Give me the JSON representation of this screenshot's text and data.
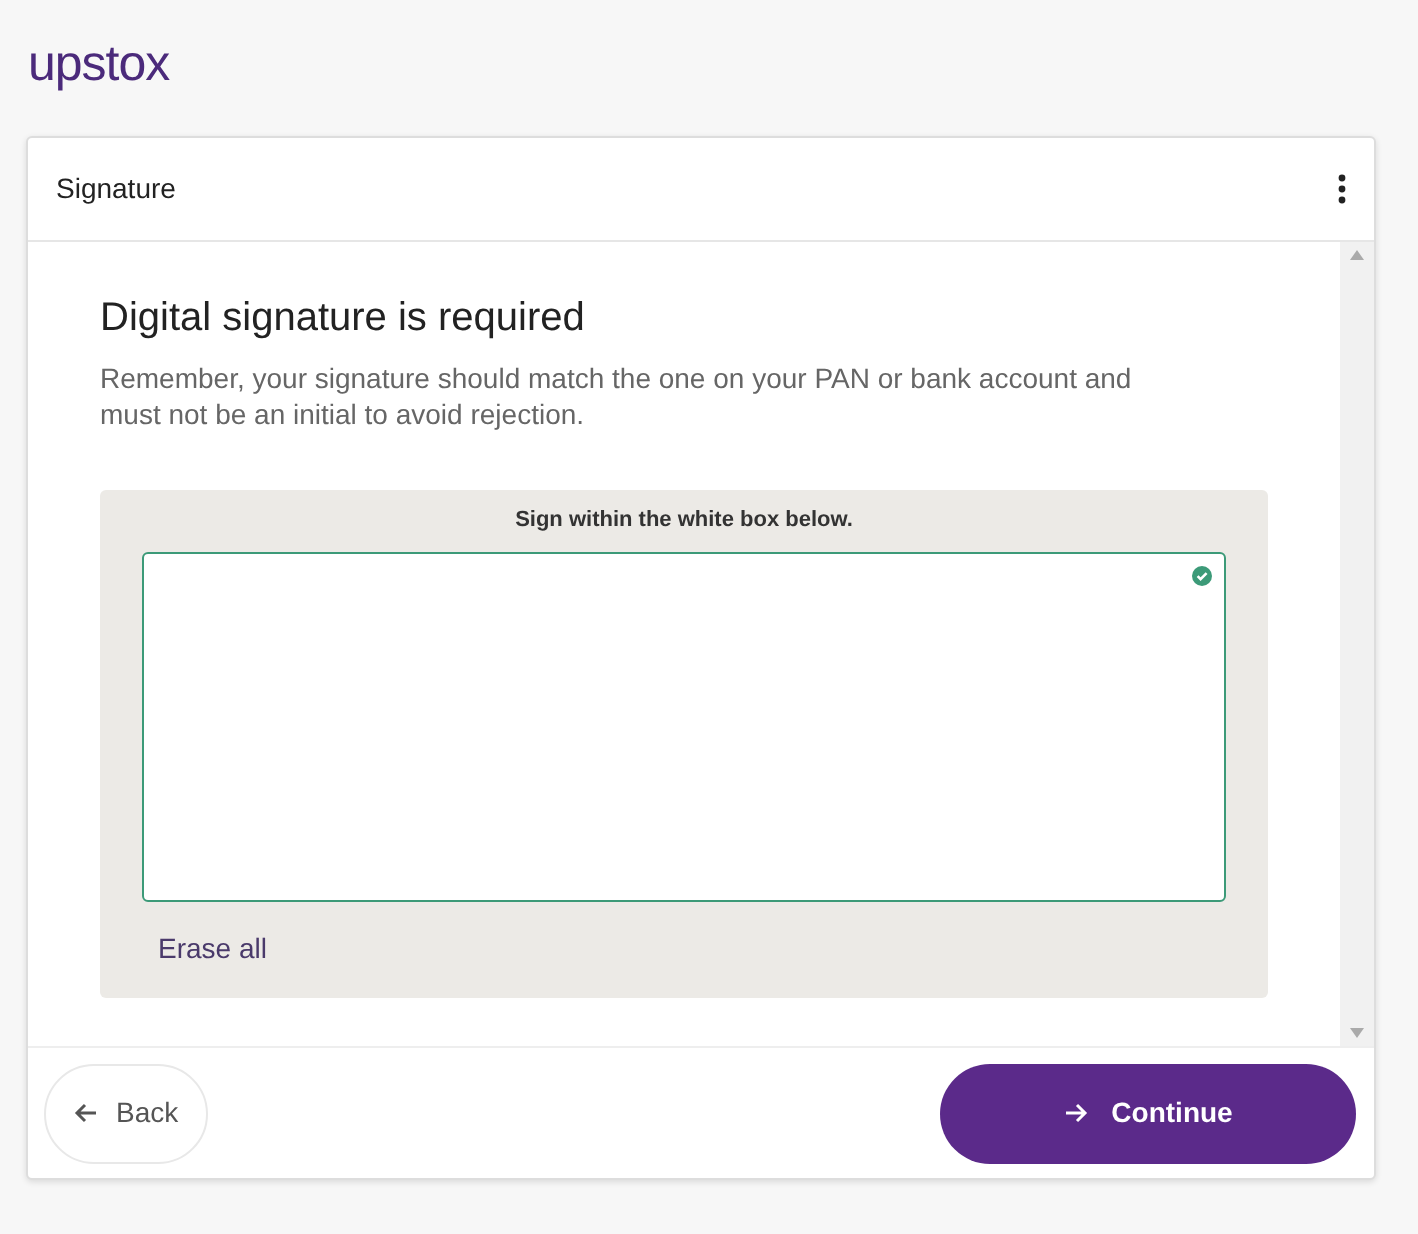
{
  "logo": {
    "text": "upstox"
  },
  "card": {
    "title": "Signature",
    "heading": "Digital signature is required",
    "description": "Remember, your signature should match the one on your PAN or bank account and must not be an initial to avoid rejection.",
    "pad": {
      "instruction": "Sign within the white box below.",
      "erase": "Erase all"
    },
    "buttons": [
      {
        "kind": "back",
        "label": "Back"
      },
      {
        "kind": "continue",
        "label": "Continue"
      }
    ]
  }
}
